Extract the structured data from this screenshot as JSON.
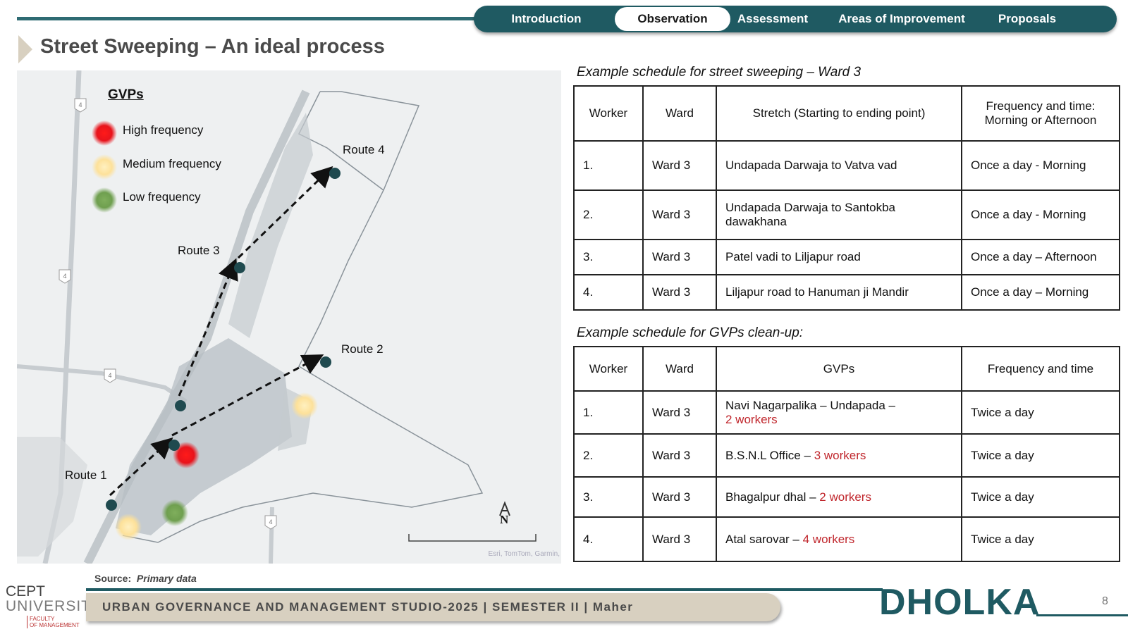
{
  "nav": {
    "tabs": [
      {
        "label": "Introduction",
        "active": false
      },
      {
        "label": "Observation",
        "active": true
      },
      {
        "label": "Assessment",
        "active": false
      },
      {
        "label": "Areas of Improvement",
        "active": false
      },
      {
        "label": "Proposals",
        "active": false
      }
    ]
  },
  "page_title": "Street Sweeping – An ideal process",
  "map": {
    "legend_title": "GVPs",
    "legend": [
      {
        "label": "High frequency",
        "color": "#e8141c"
      },
      {
        "label": "Medium frequency",
        "color": "#fde19a"
      },
      {
        "label": "Low frequency",
        "color": "#6f9f4f"
      }
    ],
    "routes": [
      "Route 1",
      "Route 2",
      "Route 3",
      "Route 4"
    ],
    "north_label": "N",
    "road_shield": "4",
    "attribution": "Esri, TomTom, Garmin,"
  },
  "sweeping": {
    "title": "Example schedule for street sweeping – Ward 3",
    "headers": [
      "Worker",
      "Ward",
      "Stretch  (Starting to ending point)",
      "Frequency and time: Morning or Afternoon"
    ],
    "rows": [
      {
        "worker": "1.",
        "ward": "Ward 3",
        "stretch": "Undapada Darwaja to Vatva vad",
        "freq": "Once a day  - Morning"
      },
      {
        "worker": "2.",
        "ward": "Ward 3",
        "stretch": "Undapada Darwaja to Santokba dawakhana",
        "freq": "Once a day - Morning"
      },
      {
        "worker": "3.",
        "ward": "Ward 3",
        "stretch": "Patel vadi to Liljapur road",
        "freq": "Once a day – Afternoon"
      },
      {
        "worker": "4.",
        "ward": "Ward 3",
        "stretch": "Liljapur road to Hanuman ji Mandir",
        "freq": "Once a day – Morning"
      }
    ]
  },
  "gvp": {
    "title": "Example schedule for GVPs clean-up:",
    "headers": [
      "Worker",
      "Ward",
      "GVPs",
      "Frequency and time"
    ],
    "rows": [
      {
        "worker": "1.",
        "ward": "Ward 3",
        "place": "Navi Nagarpalika – Undapada –",
        "workers": "2 workers",
        "freq": "Twice a day"
      },
      {
        "worker": "2.",
        "ward": "Ward 3",
        "place": "B.S.N.L Office –",
        "workers": "3 workers",
        "freq": "Twice a day"
      },
      {
        "worker": "3.",
        "ward": "Ward 3",
        "place": "Bhagalpur dhal –",
        "workers": "2 workers",
        "freq": "Twice a day"
      },
      {
        "worker": "4.",
        "ward": "Ward 3",
        "place": "Atal sarovar –",
        "workers": "4 workers",
        "freq": "Twice a day"
      }
    ]
  },
  "source": {
    "label": "Source:",
    "value": "Primary data"
  },
  "logo": {
    "line1": "CEPT",
    "line2": "UNIVERSITY",
    "line3a": "FACULTY",
    "line3b": "OF MANAGEMENT"
  },
  "footer": {
    "text": "URBAN GOVERNANCE AND MANAGEMENT STUDIO-2025 | SEMESTER II | Maher",
    "city": "DHOLKA",
    "page": "8"
  }
}
